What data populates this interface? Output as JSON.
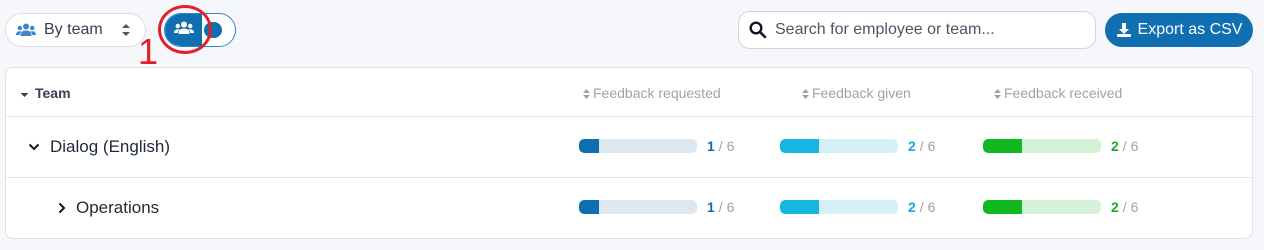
{
  "toolbar": {
    "group_select": {
      "value": "By team",
      "icon": "users-icon"
    },
    "view_toggle": {
      "icon": "users-icon",
      "state": "on"
    },
    "annotation": {
      "label": "1",
      "color": "#e0212b"
    },
    "search": {
      "placeholder": "Search for employee or team..."
    },
    "export": {
      "label": "Export as CSV",
      "icon": "download-icon"
    }
  },
  "table": {
    "columns": {
      "team": "Team",
      "requested": "Feedback requested",
      "given": "Feedback given",
      "received": "Feedback received"
    },
    "rows": [
      {
        "name": "Dialog (English)",
        "expanded": true,
        "requested": {
          "count": "1",
          "total": "/ 6",
          "fraction": 0.1667
        },
        "given": {
          "count": "2",
          "total": "/ 6",
          "fraction": 0.3333
        },
        "received": {
          "count": "2",
          "total": "/ 6",
          "fraction": 0.3333
        }
      },
      {
        "name": "Operations",
        "expanded": false,
        "requested": {
          "count": "1",
          "total": "/ 6",
          "fraction": 0.1667
        },
        "given": {
          "count": "2",
          "total": "/ 6",
          "fraction": 0.3333
        },
        "received": {
          "count": "2",
          "total": "/ 6",
          "fraction": 0.3333
        }
      }
    ]
  },
  "colors": {
    "primary": "#0f6fb0",
    "requested": "#106db0",
    "given": "#17b6e2",
    "received": "#12b81f"
  }
}
